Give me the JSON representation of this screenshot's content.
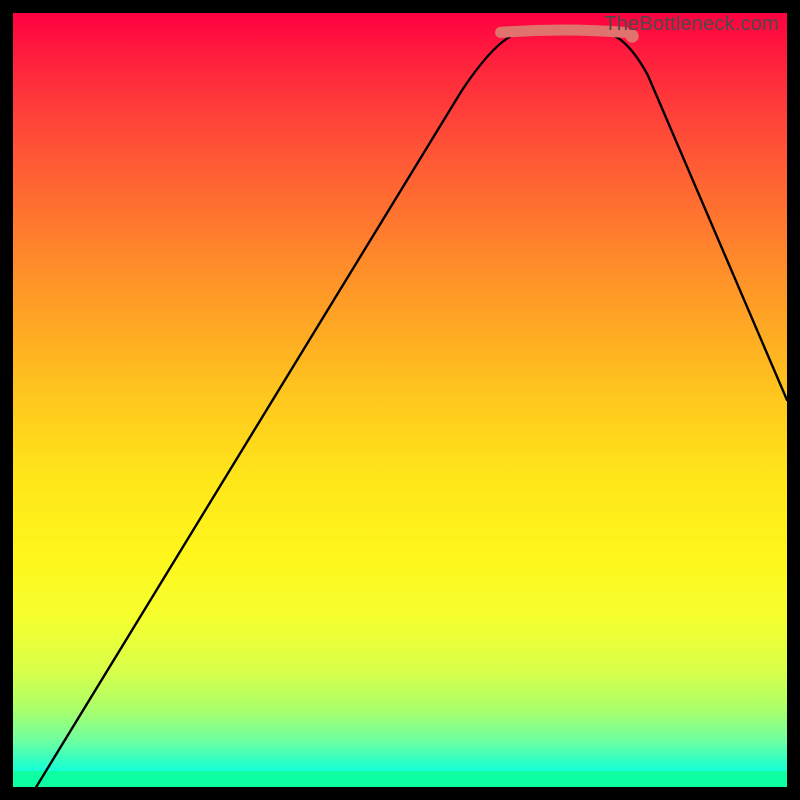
{
  "watermark": "TheBottleneck.com",
  "chart_data": {
    "type": "line",
    "title": "",
    "xlabel": "",
    "ylabel": "",
    "xlim": [
      0,
      1
    ],
    "ylim": [
      0,
      1
    ],
    "gradient_stops": [
      {
        "pos": 0.0,
        "color": "#ff0040"
      },
      {
        "pos": 0.32,
        "color": "#ff8a2a"
      },
      {
        "pos": 0.6,
        "color": "#ffe61a"
      },
      {
        "pos": 0.85,
        "color": "#d8ff4a"
      },
      {
        "pos": 1.0,
        "color": "#08ffd0"
      }
    ],
    "series": [
      {
        "name": "bottleneck-curve",
        "color": "#000000",
        "points": [
          {
            "x": 0.03,
            "y": 0.0
          },
          {
            "x": 0.64,
            "y": 0.97
          },
          {
            "x": 0.78,
            "y": 0.97
          },
          {
            "x": 1.0,
            "y": 0.5
          }
        ]
      }
    ],
    "markers": [
      {
        "name": "flat-region",
        "color": "#e0736e",
        "kind": "segment",
        "points": [
          {
            "x": 0.63,
            "y": 0.975
          },
          {
            "x": 0.79,
            "y": 0.975
          }
        ]
      },
      {
        "name": "flat-end-dot",
        "color": "#e0736e",
        "kind": "dot",
        "point": {
          "x": 0.8,
          "y": 0.97
        }
      }
    ]
  }
}
